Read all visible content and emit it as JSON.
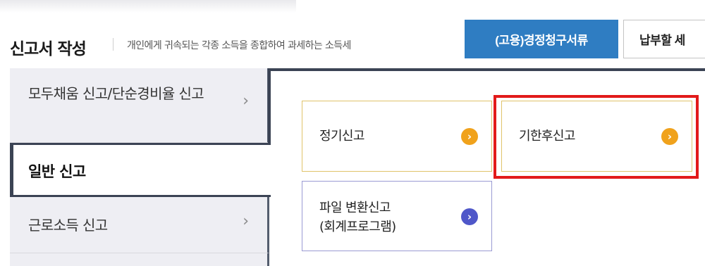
{
  "header": {
    "title": "신고서 작성",
    "subtitle": "개인에게 귀속되는 각종 소득을 종합하여 과세하는 소득세",
    "buttons": [
      {
        "label": "(고용)경정청구서류"
      },
      {
        "label": "납부할 세"
      }
    ]
  },
  "sidebar": {
    "items": [
      {
        "label": "모두채움 신고/단순경비율 신고",
        "icon": "chevron-right-icon"
      },
      {
        "label": "일반 신고",
        "active": true
      },
      {
        "label": "근로소득 신고",
        "icon": "chevron-right-icon"
      }
    ]
  },
  "cards": [
    {
      "label": "정기신고",
      "icon": "circle-arrow-right-icon",
      "accent": "#f0a21c"
    },
    {
      "label": "기한후신고",
      "icon": "circle-arrow-right-icon",
      "accent": "#f0a21c",
      "highlighted": true
    },
    {
      "label_line1": "파일 변환신고",
      "label_line2": "(회계프로그램)",
      "icon": "circle-arrow-right-icon",
      "accent": "#4f57c9"
    }
  ],
  "colors": {
    "primary_button": "#2f7dc2",
    "navy": "#3b4354",
    "highlight": "#e21a1a"
  }
}
